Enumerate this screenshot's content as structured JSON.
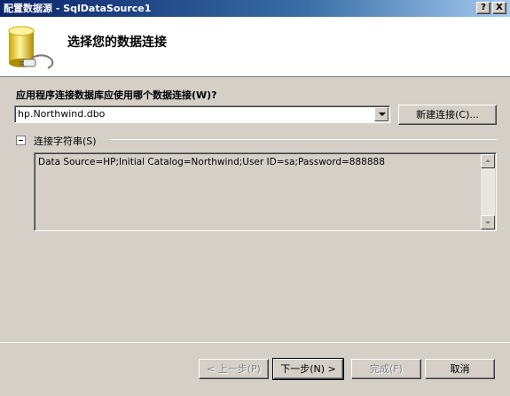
{
  "window": {
    "title": "配置数据源 - SqlDataSource1",
    "help_button": "?",
    "close_button": "X"
  },
  "header": {
    "title": "选择您的数据连接",
    "icon": "database-icon"
  },
  "question": "应用程序连接数据库应使用哪个数据连接(W)?",
  "connection_select": {
    "value": "hp.Northwind.dbo"
  },
  "new_connection_button": "新建连接(C)...",
  "connection_string": {
    "label": "连接字符串(S)",
    "value": "Data Source=HP;Initial Catalog=Northwind;User ID=sa;Password=888888",
    "expanded": true
  },
  "footer": {
    "prev_button": "< 上一步(P)",
    "next_button": "下一步(N) >",
    "finish_button": "完成(F)",
    "cancel_button": "取消"
  },
  "colors": {
    "titlebar_start": "#0a246a",
    "titlebar_end": "#a6caf0",
    "dialog_bg": "#d4d0c8",
    "header_bg": "#ffffff"
  }
}
